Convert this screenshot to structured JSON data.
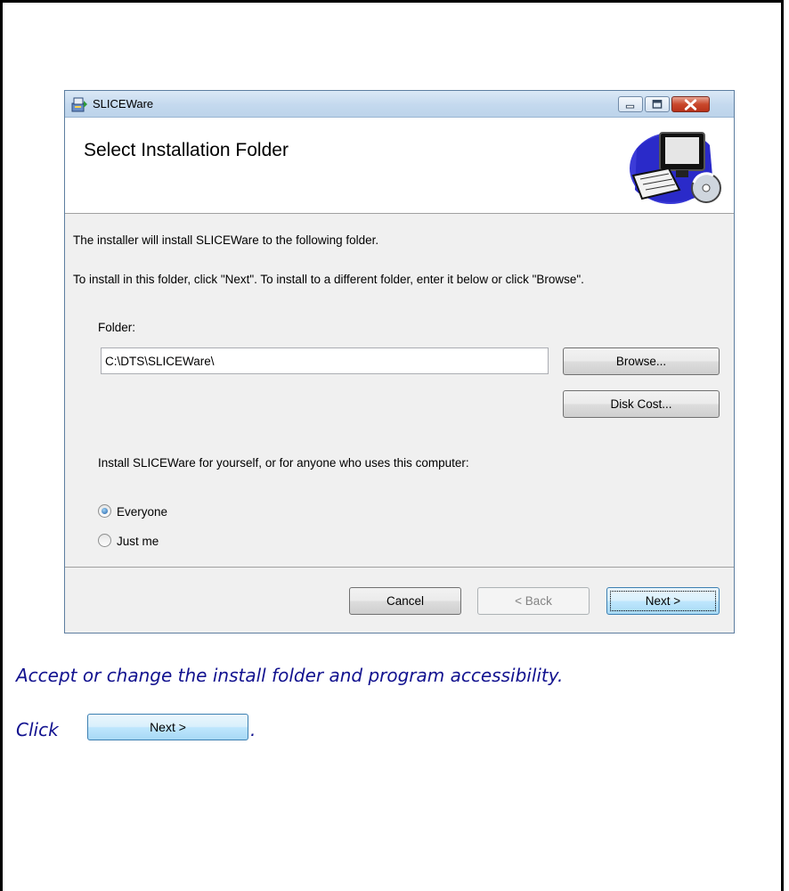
{
  "window": {
    "title": "SLICEWare",
    "header_title": "Select Installation Folder",
    "icons": [
      "installer-app-icon",
      "minimize-icon",
      "maximize-icon",
      "close-icon",
      "computer-cd-icon"
    ]
  },
  "body": {
    "line1": "The installer will install SLICEWare to the following folder.",
    "line2": "To install in this folder, click \"Next\". To install to a different folder, enter it below or click \"Browse\".",
    "folder_label": "Folder:",
    "folder_value": "C:\\DTS\\SLICEWare\\",
    "browse_label": "Browse...",
    "disk_cost_label": "Disk Cost...",
    "install_for_text": "Install SLICEWare for yourself, or for anyone who uses this computer:",
    "radio_everyone": "Everyone",
    "radio_just_me": "Just me",
    "selected_option": "Everyone"
  },
  "footer": {
    "cancel_label": "Cancel",
    "back_label": "< Back",
    "next_label": "Next >"
  },
  "instructions": {
    "caption": "Accept or change the install folder and program accessibility.",
    "click_prefix": "Click",
    "click_button_label": "Next >",
    "click_suffix": "."
  },
  "colors": {
    "caption_text": "#12128f",
    "next_button_accent": "#3c7fb1",
    "close_button": "#c9482c"
  }
}
